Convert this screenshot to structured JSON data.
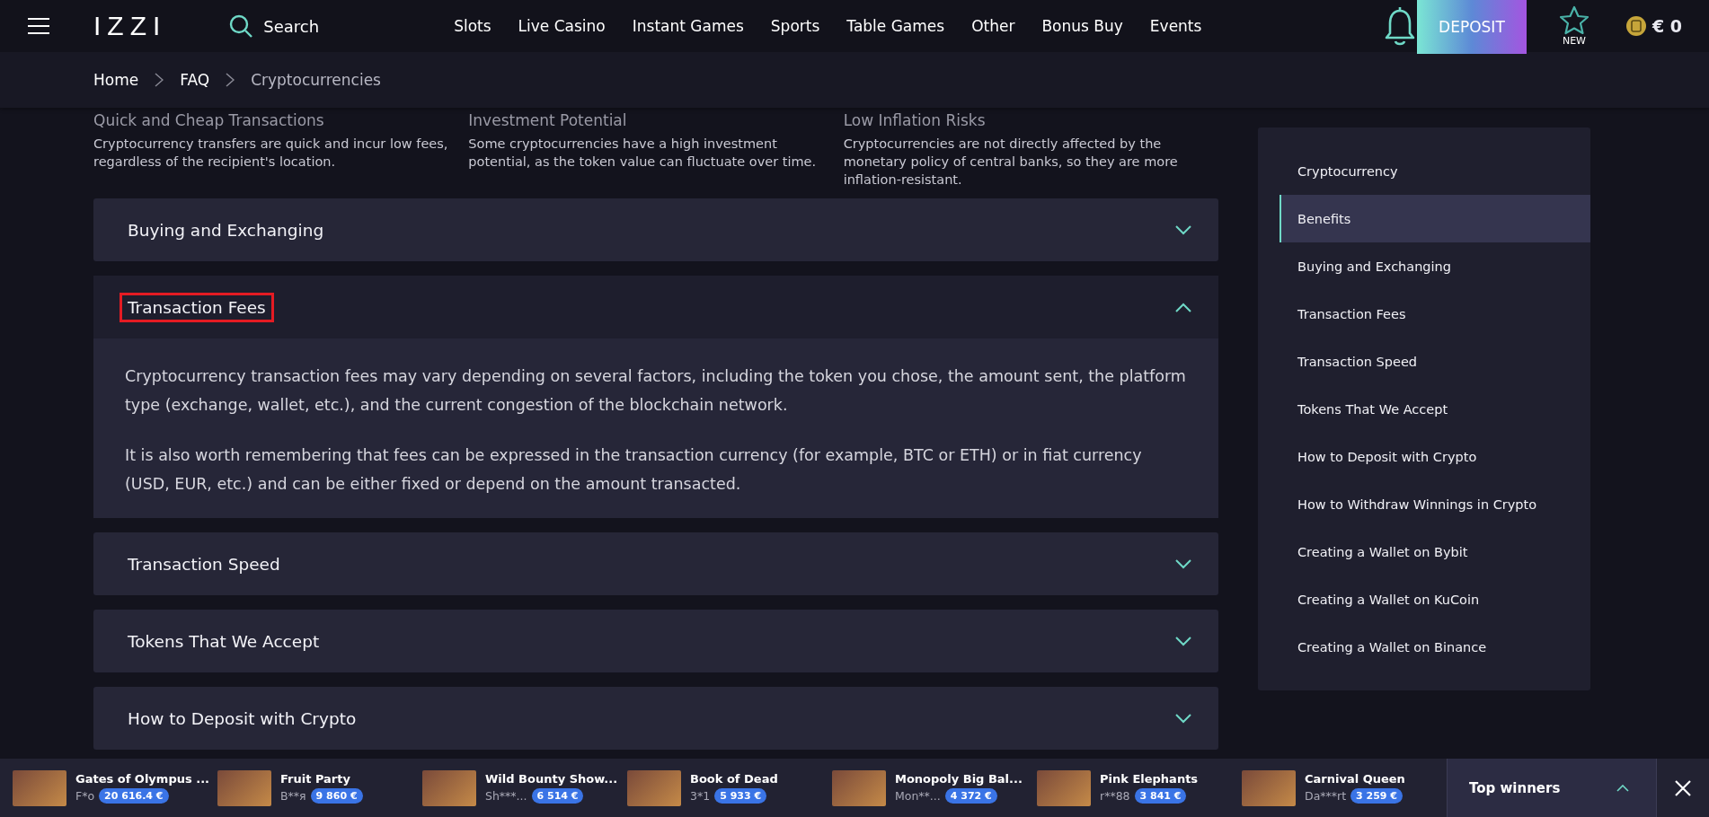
{
  "header": {
    "logo": "IZZI",
    "search_label": "Search",
    "nav": [
      "Slots",
      "Live Casino",
      "Instant Games",
      "Sports",
      "Table Games",
      "Other",
      "Bonus Buy",
      "Events"
    ],
    "deposit_label": "DEPOSIT",
    "new_label": "NEW",
    "balance": "€ 0"
  },
  "breadcrumb": [
    "Home",
    "FAQ",
    "Cryptocurrencies"
  ],
  "features": [
    {
      "title": "Quick and Cheap Transactions",
      "text": "Cryptocurrency transfers are quick and incur low fees, regardless of the recipient's location."
    },
    {
      "title": "Investment Potential",
      "text": "Some cryptocurrencies have a high investment potential, as the token value can fluctuate over time."
    },
    {
      "title": "Low Inflation Risks",
      "text": "Cryptocurrencies are not directly affected by the monetary policy of central banks, so they are more inflation-resistant."
    }
  ],
  "accordion": [
    {
      "title": "Buying and Exchanging",
      "expanded": false,
      "outlined": false
    },
    {
      "title": "Transaction Fees",
      "expanded": true,
      "outlined": true,
      "paragraphs": [
        "Cryptocurrency transaction fees may vary depending on several factors, including the token you chose, the amount sent, the platform type (exchange, wallet, etc.), and the current congestion of the blockchain network.",
        "It is also worth remembering that fees can be expressed in the transaction currency (for example, BTC or ETH) or in fiat currency (USD, EUR, etc.) and can be either fixed or depend on the amount transacted."
      ]
    },
    {
      "title": "Transaction Speed",
      "expanded": false,
      "outlined": false
    },
    {
      "title": "Tokens That We Accept",
      "expanded": false,
      "outlined": false
    },
    {
      "title": "How to Deposit with Crypto",
      "expanded": false,
      "outlined": false
    }
  ],
  "sidebar": {
    "items": [
      {
        "label": "Cryptocurrency",
        "selected": false
      },
      {
        "label": "Benefits",
        "selected": true
      },
      {
        "label": "Buying and Exchanging",
        "selected": false
      },
      {
        "label": "Transaction Fees",
        "selected": false
      },
      {
        "label": "Transaction Speed",
        "selected": false
      },
      {
        "label": "Tokens That We Accept",
        "selected": false
      },
      {
        "label": "How to Deposit with Crypto",
        "selected": false
      },
      {
        "label": "How to Withdraw Winnings in Crypto",
        "selected": false
      },
      {
        "label": "Creating a Wallet on Bybit",
        "selected": false
      },
      {
        "label": "Creating a Wallet on KuCoin",
        "selected": false
      },
      {
        "label": "Creating a Wallet on Binance",
        "selected": false
      }
    ]
  },
  "winners": {
    "items": [
      {
        "game": "Gates of Olympus ...",
        "user": "F*o",
        "amount": "20 616.4 €"
      },
      {
        "game": "Fruit Party",
        "user": "B**я",
        "amount": "9 860 €"
      },
      {
        "game": "Wild Bounty Show...",
        "user": "Sh***...",
        "amount": "6 514 €"
      },
      {
        "game": "Book of Dead",
        "user": "3*1",
        "amount": "5 933 €"
      },
      {
        "game": "Monopoly Big Bal...",
        "user": "Mon**...",
        "amount": "4 372 €"
      },
      {
        "game": "Pink Elephants",
        "user": "r**88",
        "amount": "3 841 €"
      },
      {
        "game": "Carnival Queen",
        "user": "Da***rt",
        "amount": "3 259 €"
      }
    ],
    "title": "Top winners"
  }
}
